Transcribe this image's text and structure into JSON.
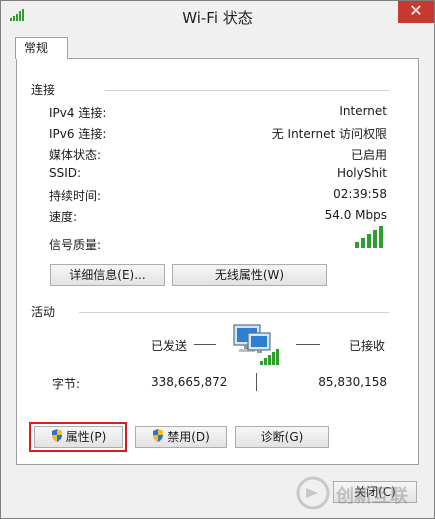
{
  "window": {
    "title": "Wi-Fi 状态",
    "close_glyph": "✕"
  },
  "tab": {
    "label": "常规"
  },
  "connection": {
    "heading": "连接",
    "rows": [
      {
        "label": "IPv4 连接:",
        "value": "Internet"
      },
      {
        "label": "IPv6 连接:",
        "value": "无 Internet 访问权限"
      },
      {
        "label": "媒体状态:",
        "value": "已启用"
      },
      {
        "label": "SSID:",
        "value": "HolyShit"
      },
      {
        "label": "持续时间:",
        "value": "02:39:58"
      },
      {
        "label": "速度:",
        "value": "54.0 Mbps"
      }
    ],
    "signal_label": "信号质量:",
    "signal_bars": 5
  },
  "buttons_top": {
    "details": "详细信息(E)...",
    "wireless": "无线属性(W)"
  },
  "activity": {
    "heading": "活动",
    "sent_label": "已发送",
    "received_label": "已接收",
    "bytes_label": "字节:",
    "bytes_sent": "338,665,872",
    "bytes_received": "85,830,158"
  },
  "buttons_bottom": {
    "properties": "属性(P)",
    "disable": "禁用(D)",
    "diagnose": "诊断(G)"
  },
  "footer": {
    "close": "关闭(C)"
  },
  "watermark": {
    "text": "创新互联"
  },
  "colors": {
    "accent_red": "#d81e1e",
    "signal_green": "#2e9e2e",
    "close_red": "#c83a2f"
  }
}
